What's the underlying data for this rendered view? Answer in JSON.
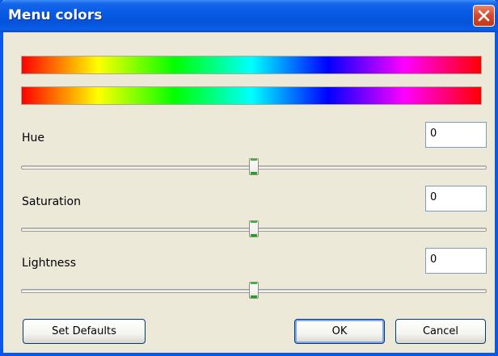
{
  "window": {
    "title": "Menu colors"
  },
  "fields": [
    {
      "label": "Hue",
      "value": "0",
      "slider_fraction": 0.5
    },
    {
      "label": "Saturation",
      "value": "0",
      "slider_fraction": 0.5
    },
    {
      "label": "Lightness",
      "value": "0",
      "slider_fraction": 0.5
    }
  ],
  "buttons": {
    "set_defaults": "Set Defaults",
    "ok": "OK",
    "cancel": "Cancel"
  },
  "colors": {
    "titlebar": "#0758e3",
    "dialog_bg": "#ece9d8",
    "close": "#d4472a"
  }
}
